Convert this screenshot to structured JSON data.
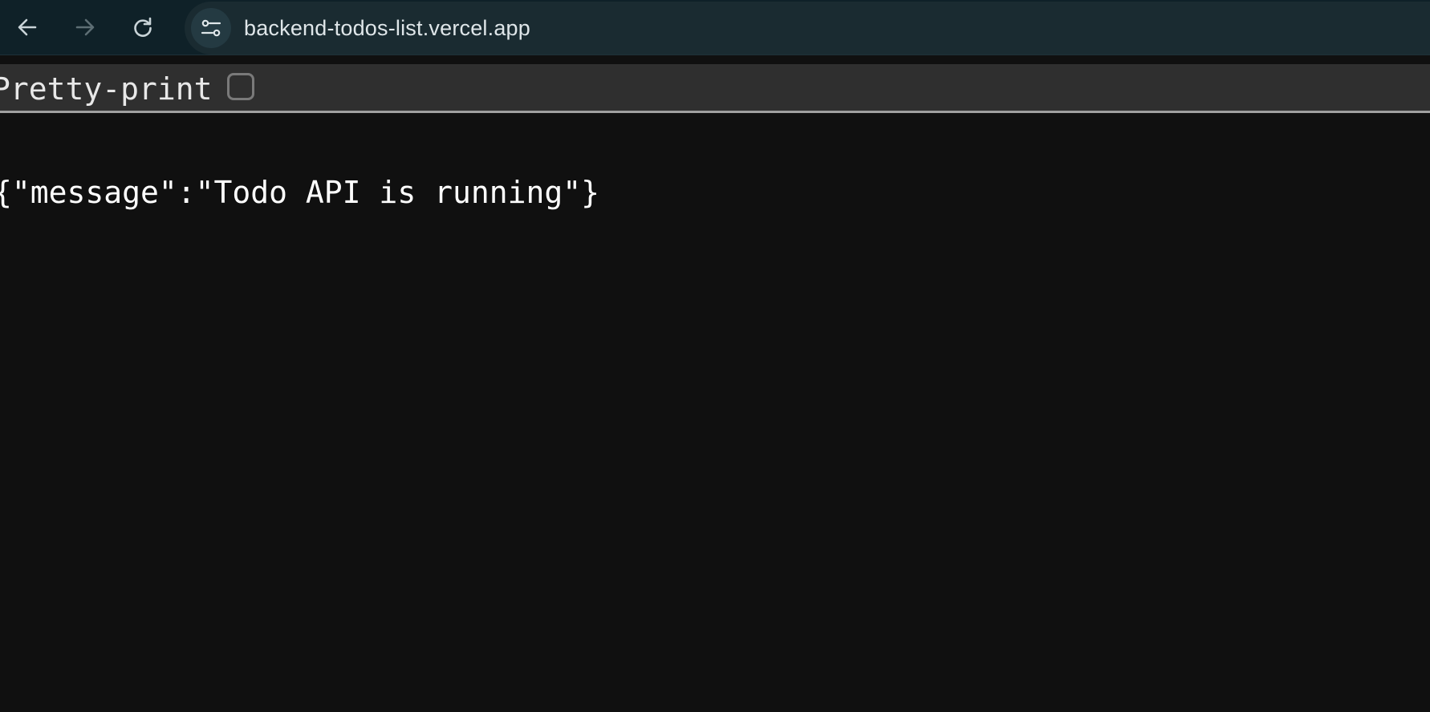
{
  "browser": {
    "url": "backend-todos-list.vercel.app",
    "icons": {
      "back": "arrow-left-icon",
      "forward": "arrow-right-icon",
      "reload": "reload-icon",
      "site_info": "tune-icon"
    }
  },
  "viewer": {
    "pretty_print_label": "Pretty-print",
    "pretty_print_checked": false
  },
  "content": {
    "json_text": "{\"message\":\"Todo API is running\"}"
  },
  "colors": {
    "toolbar_bg": "#0f2128",
    "page_bg": "#101010",
    "bar_bg": "#2f2f2f"
  }
}
